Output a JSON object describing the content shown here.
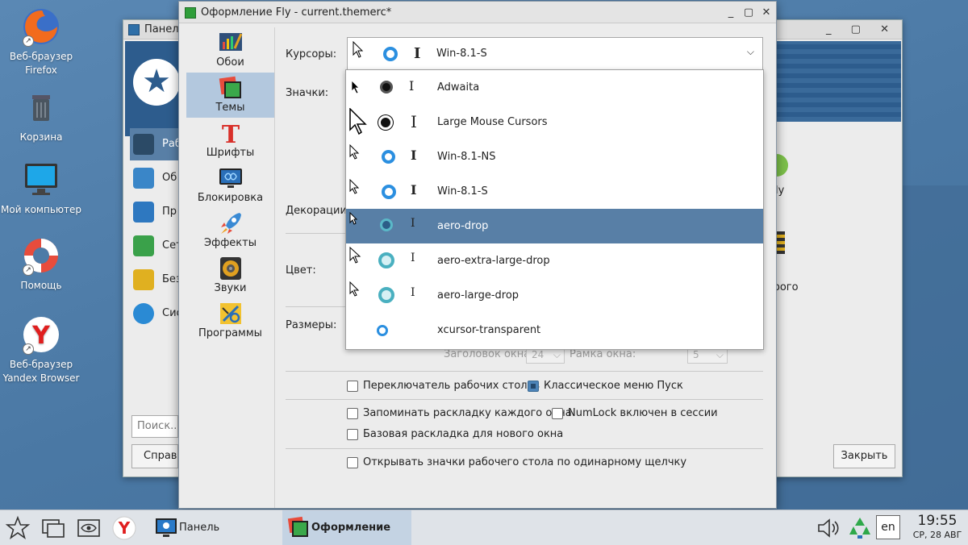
{
  "desktop": {
    "icons": [
      {
        "icon": "firefox-icon",
        "label": "Веб-браузер Firefox"
      },
      {
        "icon": "trash-icon",
        "label": "Корзина"
      },
      {
        "icon": "computer-icon",
        "label": "Мой компьютер"
      },
      {
        "icon": "lifebuoy-icon",
        "label": "Помощь"
      },
      {
        "icon": "yandex-icon",
        "label": "Веб-браузер Yandex Browser"
      }
    ]
  },
  "control_panel": {
    "title": "Панель",
    "sidebar": [
      "Раб",
      "Об",
      "Пр",
      "Сет",
      "Без",
      "Сис"
    ],
    "search_placeholder": "Поиск...",
    "help_label": "Справк",
    "close_label": "Закрыть",
    "right_labels": [
      "ly",
      "трого"
    ]
  },
  "dialog": {
    "title": "Оформление Fly - current.themerc*",
    "categories": [
      {
        "icon": "wallpaper-icon",
        "label": "Обои"
      },
      {
        "icon": "themes-icon",
        "label": "Темы"
      },
      {
        "icon": "fonts-icon",
        "label": "Шрифты"
      },
      {
        "icon": "lock-icon",
        "label": "Блокировка"
      },
      {
        "icon": "effects-icon",
        "label": "Эффекты"
      },
      {
        "icon": "sounds-icon",
        "label": "Звуки"
      },
      {
        "icon": "programs-icon",
        "label": "Программы"
      }
    ],
    "active_category": "Темы",
    "labels": {
      "cursors": "Курсоры:",
      "icons": "Значки:",
      "decorations": "Декорации:",
      "color": "Цвет:",
      "sizes": "Размеры:"
    },
    "cursor_combo_value": "Win-8.1-S",
    "cursor_options": [
      "Adwaita",
      "Large Mouse Cursors",
      "Win-8.1-NS",
      "Win-8.1-S",
      "aero-drop",
      "aero-extra-large-drop",
      "aero-large-drop",
      "xcursor-transparent"
    ],
    "selected_option": "aero-drop",
    "size_fields": {
      "title_label": "Заголовок окна:",
      "title_value": "24",
      "frame_label": "Рамка окна:",
      "frame_value": "5"
    },
    "checkboxes": [
      {
        "label": "Переключатель рабочих столов",
        "checked": false
      },
      {
        "label": "Классическое меню Пуск",
        "checked": true
      },
      {
        "label": "Запоминать раскладку каждого окна",
        "checked": false
      },
      {
        "label": "NumLock включен в сессии",
        "checked": false
      },
      {
        "label": "Базовая раскладка для нового окна",
        "checked": false
      },
      {
        "label": "Открывать значки рабочего стола по одинарному щелчку",
        "checked": false
      }
    ]
  },
  "taskbar": {
    "tasks": [
      {
        "label": "Панель управления",
        "active": false
      },
      {
        "label": "Оформление Fly",
        "active": true
      }
    ],
    "language": "en",
    "time": "19:55",
    "date": "СР, 28 АВГ"
  }
}
